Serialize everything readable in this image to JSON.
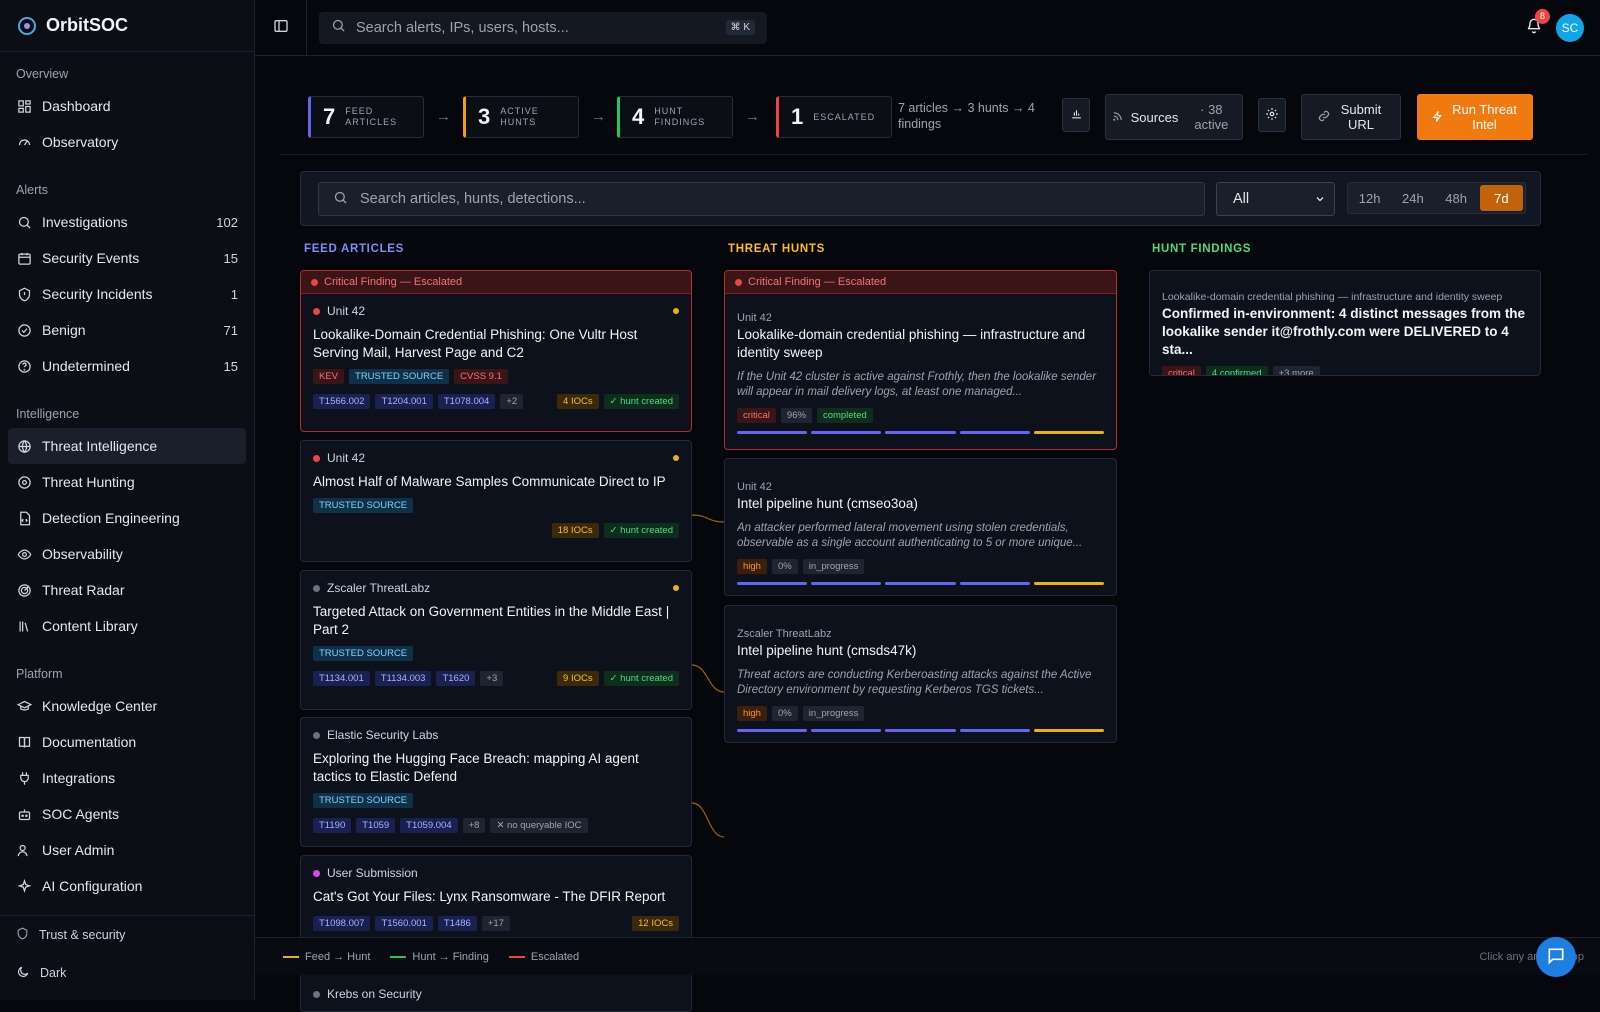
{
  "app": {
    "name": "OrbitSOC"
  },
  "search": {
    "placeholder": "Search alerts, IPs, users, hosts...",
    "shortcut": "⌘ K"
  },
  "notifications": {
    "count": "8"
  },
  "user": {
    "initials": "SC"
  },
  "sidebar": {
    "sections": [
      {
        "title": "Overview",
        "items": [
          {
            "label": "Dashboard",
            "icon": "dashboard-icon",
            "count": ""
          },
          {
            "label": "Observatory",
            "icon": "gauge-icon",
            "count": ""
          }
        ]
      },
      {
        "title": "Alerts",
        "items": [
          {
            "label": "Investigations",
            "icon": "search-icon",
            "count": "102"
          },
          {
            "label": "Security Events",
            "icon": "calendar-icon",
            "count": "15"
          },
          {
            "label": "Security Incidents",
            "icon": "shield-alert-icon",
            "count": "1"
          },
          {
            "label": "Benign",
            "icon": "check-circle-icon",
            "count": "71"
          },
          {
            "label": "Undetermined",
            "icon": "help-circle-icon",
            "count": "15"
          }
        ]
      },
      {
        "title": "Intelligence",
        "items": [
          {
            "label": "Threat Intelligence",
            "icon": "globe-icon",
            "count": "",
            "active": true
          },
          {
            "label": "Threat Hunting",
            "icon": "crosshair-icon",
            "count": ""
          },
          {
            "label": "Detection Engineering",
            "icon": "code-file-icon",
            "count": ""
          },
          {
            "label": "Observability",
            "icon": "eye-icon",
            "count": ""
          },
          {
            "label": "Threat Radar",
            "icon": "radar-icon",
            "count": ""
          },
          {
            "label": "Content Library",
            "icon": "library-icon",
            "count": ""
          }
        ]
      },
      {
        "title": "Platform",
        "items": [
          {
            "label": "Knowledge Center",
            "icon": "graduation-icon",
            "count": ""
          },
          {
            "label": "Documentation",
            "icon": "book-icon",
            "count": ""
          },
          {
            "label": "Integrations",
            "icon": "plug-icon",
            "count": ""
          },
          {
            "label": "SOC Agents",
            "icon": "bot-icon",
            "count": ""
          },
          {
            "label": "User Admin",
            "icon": "users-icon",
            "count": ""
          },
          {
            "label": "AI Configuration",
            "icon": "sparkles-icon",
            "count": ""
          }
        ]
      }
    ],
    "footer": {
      "trust": "Trust & security",
      "theme": "Dark"
    }
  },
  "pipeline": {
    "stages": [
      {
        "num": "7",
        "label": "FEED\nARTICLES",
        "color": "#6366f1"
      },
      {
        "num": "3",
        "label": "ACTIVE\nHUNTS",
        "color": "#f59e0b"
      },
      {
        "num": "4",
        "label": "HUNT\nFINDINGS",
        "color": "#22c55e"
      },
      {
        "num": "1",
        "label": "ESCALATED",
        "color": "#ef4444"
      }
    ],
    "summary": "7 articles → 3 hunts → 4 findings",
    "sources_label": "Sources",
    "sources_count": "· 38 active",
    "submit_label": "Submit URL",
    "run_label": "Run Threat Intel"
  },
  "filters": {
    "search_placeholder": "Search articles, hunts, detections...",
    "select_value": "All",
    "time_options": [
      "12h",
      "24h",
      "48h",
      "7d"
    ],
    "time_selected": "7d"
  },
  "columns": {
    "feed": {
      "title": "FEED ARTICLES",
      "color": "#818cf8"
    },
    "hunts": {
      "title": "THREAT HUNTS",
      "color": "#fbbf24"
    },
    "findings": {
      "title": "HUNT FINDINGS",
      "color": "#4ade80"
    }
  },
  "escalated_label": "Critical Finding — Escalated",
  "feed_articles": [
    {
      "source": "Unit 42",
      "dot": "#ef4444",
      "title": "Lookalike-Domain Credential Phishing: One Vultr Host Serving Mail, Harvest Page and C2",
      "escalated": true,
      "badges": [
        {
          "t": "KEV",
          "c": "t-red"
        },
        {
          "t": "TRUSTED SOURCE",
          "c": "t-blue"
        },
        {
          "t": "CVSS 9.1",
          "c": "t-red"
        }
      ],
      "techniques": [
        "T1566.002",
        "T1204.001",
        "T1078.004",
        "+2"
      ],
      "iocs": "4 IOCs",
      "hunt": "✓ hunt created"
    },
    {
      "source": "Unit 42",
      "dot": "#ef4444",
      "title": "Almost Half of Malware Samples Communicate Direct to IP",
      "escalated": false,
      "badges": [
        {
          "t": "TRUSTED SOURCE",
          "c": "t-blue"
        }
      ],
      "techniques": [],
      "iocs": "18 IOCs",
      "hunt": "✓ hunt created"
    },
    {
      "source": "Zscaler ThreatLabz",
      "dot": "#6b7280",
      "title": "Targeted Attack on Government Entities in the Middle East | Part 2",
      "escalated": false,
      "badges": [
        {
          "t": "TRUSTED SOURCE",
          "c": "t-blue"
        }
      ],
      "techniques": [
        "T1134.001",
        "T1134.003",
        "T1620",
        "+3"
      ],
      "iocs": "9 IOCs",
      "hunt": "✓ hunt created"
    },
    {
      "source": "Elastic Security Labs",
      "dot": "#6b7280",
      "title": "Exploring the Hugging Face Breach: mapping AI agent tactics to Elastic Defend",
      "escalated": false,
      "badges": [
        {
          "t": "TRUSTED SOURCE",
          "c": "t-blue"
        }
      ],
      "techniques": [
        "T1190",
        "T1059",
        "T1059.004",
        "+8"
      ],
      "no_ioc": "✕ no queryable IOC",
      "iocs": "",
      "hunt": ""
    },
    {
      "source": "User Submission",
      "dot": "#d946ef",
      "title": "Cat's Got Your Files: Lynx Ransomware - The DFIR Report",
      "escalated": false,
      "badges": [],
      "techniques": [
        "T1098.007",
        "T1560.001",
        "T1486",
        "+17"
      ],
      "iocs": "12 IOCs",
      "hunt": ""
    },
    {
      "source": "Krebs on Security",
      "dot": "#6b7280",
      "title": "",
      "escalated": false,
      "badges": [],
      "techniques": [],
      "iocs": "",
      "hunt": ""
    }
  ],
  "threat_hunts": [
    {
      "source": "Unit 42",
      "title": "Lookalike-domain credential phishing — infrastructure and identity sweep",
      "escalated": true,
      "desc": "If the Unit 42 cluster is active against Frothly, then the lookalike sender will appear in mail delivery logs, at least one managed...",
      "severity": "critical",
      "progress": "96%",
      "status": "completed"
    },
    {
      "source": "Unit 42",
      "title": "Intel pipeline hunt (cmseo3oa)",
      "escalated": false,
      "desc": "An attacker performed lateral movement using stolen credentials, observable as a single account authenticating to 5 or more unique...",
      "severity": "high",
      "progress": "0%",
      "status": "in_progress"
    },
    {
      "source": "Zscaler ThreatLabz",
      "title": "Intel pipeline hunt (cmsds47k)",
      "escalated": false,
      "desc": "Threat actors are conducting Kerberoasting attacks against the Active Directory environment by requesting Kerberos TGS tickets...",
      "severity": "high",
      "progress": "0%",
      "status": "in_progress"
    }
  ],
  "hunt_findings": [
    {
      "source": "Lookalike-domain credential phishing — infrastructure and identity sweep",
      "title": "Confirmed in-environment: 4 distinct messages from the lookalike sender it@frothly.com were DELIVERED to 4 sta...",
      "severity": "critical",
      "confirmed": "4 confirmed",
      "more": "+3 more"
    }
  ],
  "legend": {
    "items": [
      {
        "label": "Feed → Hunt",
        "color": "#eab308"
      },
      {
        "label": "Hunt → Finding",
        "color": "#22c55e"
      },
      {
        "label": "Escalated",
        "color": "#ef4444"
      }
    ],
    "hint": "Click any article to op"
  }
}
